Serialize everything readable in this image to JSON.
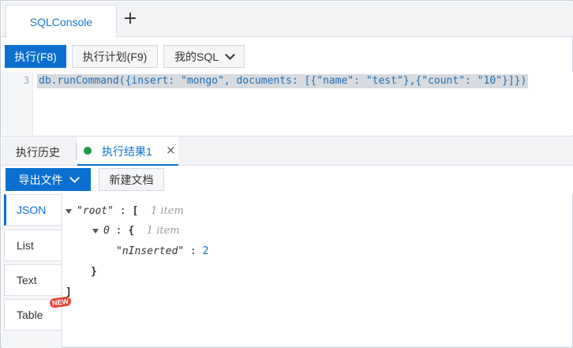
{
  "tabs": {
    "active": "SQLConsole",
    "add": "+"
  },
  "toolbar": {
    "execute": "执行(F8)",
    "plan": "执行计划(F9)",
    "mysql": "我的SQL"
  },
  "editor": {
    "line_number": "3",
    "code": "db.runCommand({insert: \"mongo\", documents: [{\"name\": \"test\"},{\"count\": \"10\"}]})"
  },
  "result_tabs": {
    "history": "执行历史",
    "result": "执行结果1",
    "close": "×"
  },
  "export": {
    "export_file": "导出文件",
    "new_doc": "新建文档"
  },
  "views": {
    "json": "JSON",
    "list": "List",
    "text": "Text",
    "table": "Table",
    "new_badge": "NEW"
  },
  "tree": {
    "root_key": "\"root\"",
    "root_open": "[",
    "root_meta": "1 item",
    "item_key": "0",
    "item_open": "{",
    "item_meta": "1 item",
    "field_key": "\"nInserted\"",
    "field_value": "2",
    "item_close": "}",
    "root_close": "]"
  },
  "colors": {
    "accent": "#0b6fd0",
    "status_dot": "#1c9b45",
    "badge": "#e5453a"
  }
}
